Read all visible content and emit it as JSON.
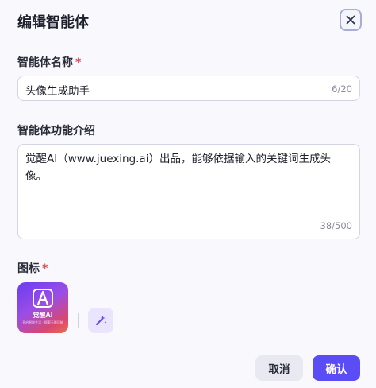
{
  "dialog": {
    "title": "编辑智能体",
    "close_icon": "close-icon"
  },
  "name_field": {
    "label": "智能体名称",
    "required_mark": "*",
    "value": "头像生成助手",
    "counter": "6/20"
  },
  "description_field": {
    "label": "智能体功能介绍",
    "value": "觉醒AI（www.juexing.ai）出品，能够依据输入的关键词生成头像。",
    "counter": "38/500"
  },
  "icon_field": {
    "label": "图标",
    "required_mark": "*",
    "logo_text": "觉醒Ai",
    "logo_slogan": "开启智能生活 · 探索无限可能",
    "ai_generate_icon": "sparkle-icon"
  },
  "footer": {
    "cancel_label": "取消",
    "confirm_label": "确认"
  },
  "colors": {
    "accent": "#5b4df5",
    "required": "#e5484d",
    "ai_button_bg": "#ebe4fd"
  }
}
